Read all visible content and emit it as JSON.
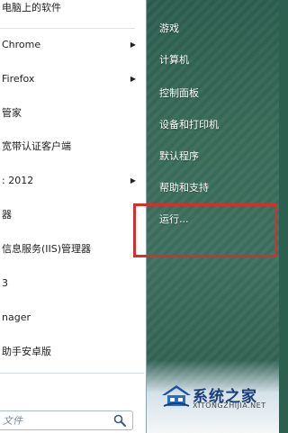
{
  "left_pane": {
    "top_title": "电脑上的软件",
    "programs": [
      {
        "label": "Chrome",
        "has_submenu": true
      },
      {
        "label": "Firefox",
        "has_submenu": true
      },
      {
        "label": "管家",
        "has_submenu": false
      },
      {
        "label": "宽带认证客户端",
        "has_submenu": false
      },
      {
        "label": ": 2012",
        "has_submenu": true
      },
      {
        "label": "器",
        "has_submenu": false
      },
      {
        "label": "信息服务(IIS)管理器",
        "has_submenu": false
      },
      {
        "label": "3",
        "has_submenu": false
      },
      {
        "label": "nager",
        "has_submenu": false
      },
      {
        "label": "助手安卓版",
        "has_submenu": false
      }
    ],
    "all_programs": "",
    "search": {
      "placeholder": "文件"
    }
  },
  "right_pane": {
    "items": [
      {
        "label": "游戏"
      },
      {
        "label": "计算机"
      },
      {
        "label": "控制面板"
      },
      {
        "label": "设备和打印机"
      },
      {
        "label": "默认程序"
      },
      {
        "label": "帮助和支持"
      },
      {
        "label": "运行..."
      }
    ],
    "highlight_color": "#d32f2f"
  },
  "watermark": {
    "title": "系统之家",
    "url": "XITONGZHIJIA.NET"
  },
  "icons": {
    "submenu_arrow": "triangle-right-icon",
    "search": "magnifier-icon"
  }
}
